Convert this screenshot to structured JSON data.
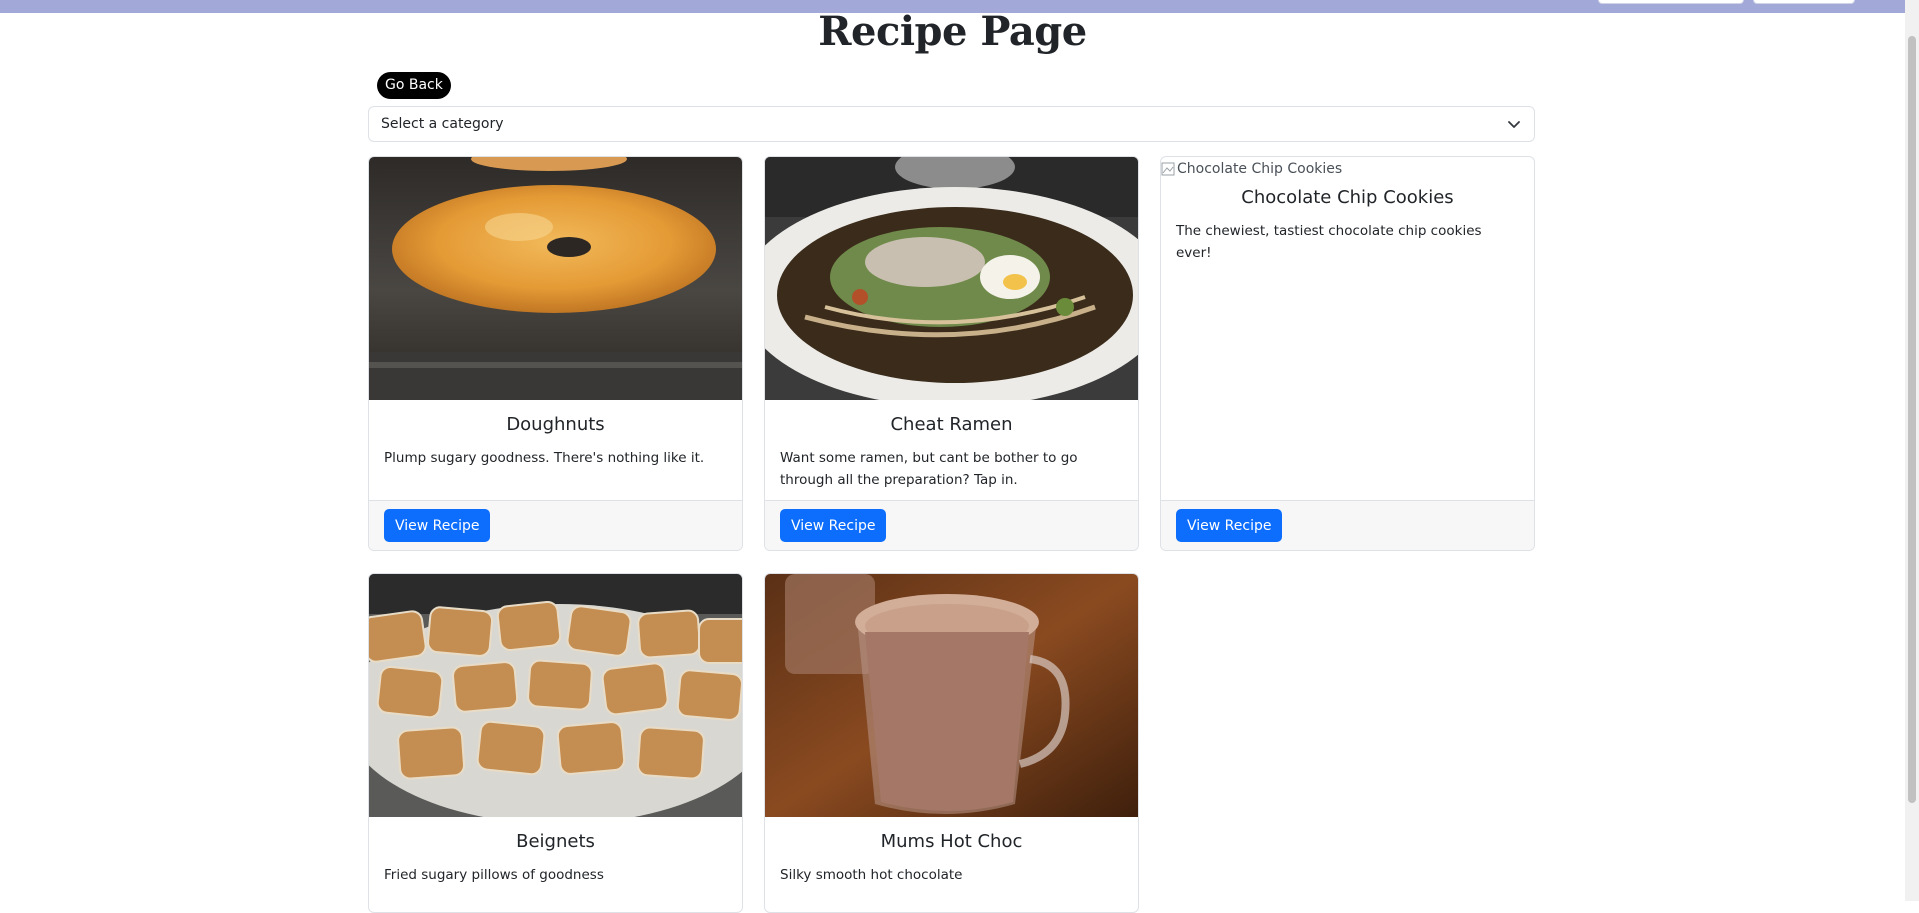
{
  "page": {
    "title": "Recipe Page",
    "go_back_label": "Go Back"
  },
  "filter": {
    "selected": "Select a category"
  },
  "recipes": [
    {
      "title": "Doughnuts",
      "description": "Plump sugary goodness. There's nothing like it.",
      "button": "View Recipe",
      "image_alt": "Doughnuts",
      "image_loaded": true
    },
    {
      "title": "Cheat Ramen",
      "description": "Want some ramen, but cant be bother to go through all the preparation? Tap in.",
      "button": "View Recipe",
      "image_alt": "Cheat Ramen",
      "image_loaded": true
    },
    {
      "title": "Chocolate Chip Cookies",
      "description": "The chewiest, tastiest chocolate chip cookies ever!",
      "button": "View Recipe",
      "image_alt": "Chocolate Chip Cookies",
      "image_loaded": false
    },
    {
      "title": "Beignets",
      "description": "Fried sugary pillows of goodness",
      "button": "View Recipe",
      "image_alt": "Beignets",
      "image_loaded": true
    },
    {
      "title": "Mums Hot Choc",
      "description": "Silky smooth hot chocolate",
      "button": "View Recipe",
      "image_alt": "Mums Hot Choc",
      "image_loaded": true
    }
  ],
  "colors": {
    "topbar": "#a2a8d8",
    "primary_button": "#0d6efd",
    "go_back_button": "#000000"
  }
}
